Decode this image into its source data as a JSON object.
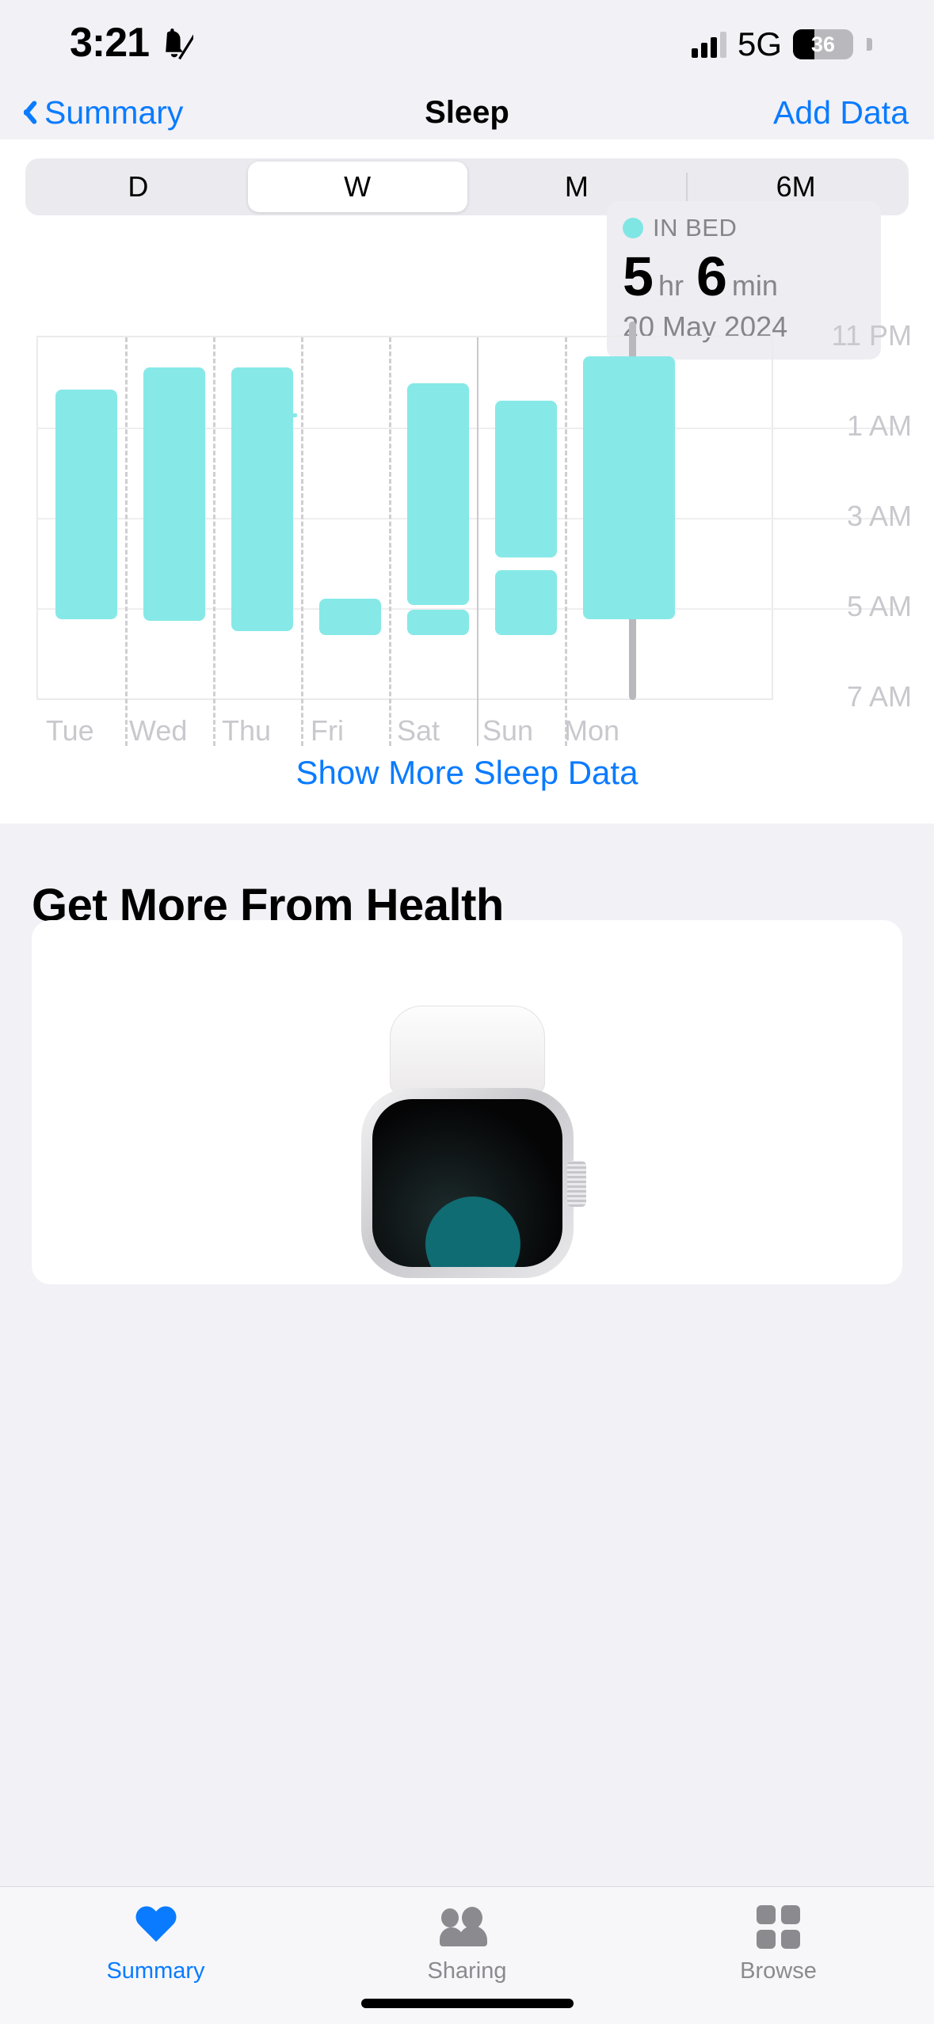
{
  "status_bar": {
    "time": "3:21",
    "silent_icon": "bell-slash-icon",
    "network": "5G",
    "battery_percent": "36"
  },
  "nav": {
    "back_label": "Summary",
    "title": "Sleep",
    "action_label": "Add Data"
  },
  "range_selector": {
    "options": [
      "D",
      "W",
      "M",
      "6M"
    ],
    "selected": "W"
  },
  "callout": {
    "label": "IN BED",
    "hours": "5",
    "hours_unit": "hr",
    "minutes": "6",
    "minutes_unit": "min",
    "date": "20 May 2024",
    "dot_color": "#7fe6e4"
  },
  "chart_data": {
    "type": "bar",
    "title": "In Bed",
    "xlabel": "",
    "ylabel": "",
    "categories": [
      "Tue",
      "Wed",
      "Thu",
      "Fri",
      "Sat",
      "Sun",
      "Mon"
    ],
    "y_tick_labels": [
      "11 PM",
      "1 AM",
      "3 AM",
      "5 AM",
      "7 AM"
    ],
    "ylim": [
      "11 PM",
      "7 AM"
    ],
    "grid": true,
    "legend": "IN BED",
    "bar_color": "#86e9e7",
    "unit": "clock time (range bars: bed time to wake time)",
    "series": [
      {
        "name": "In Bed",
        "segments": [
          {
            "day": "Tue",
            "start": "12:20 AM",
            "end": "5:05 AM"
          },
          {
            "day": "Wed",
            "start": "11:50 PM",
            "end": "5:05 AM"
          },
          {
            "day": "Thu",
            "start": "11:50 PM",
            "end": "5:20 AM"
          },
          {
            "day": "Fri",
            "start": "1:00 AM",
            "end": "1:02 AM"
          },
          {
            "day": "Fri",
            "start": "4:35 AM",
            "end": "5:20 AM"
          },
          {
            "day": "Sat",
            "start": "12:25 AM",
            "end": "4:45 AM"
          },
          {
            "day": "Sat",
            "start": "4:50 AM",
            "end": "5:20 AM"
          },
          {
            "day": "Sun",
            "start": "12:40 AM",
            "end": "3:35 AM"
          },
          {
            "day": "Sun",
            "start": "3:55 AM",
            "end": "5:20 AM"
          },
          {
            "day": "Mon",
            "start": "12:05 AM",
            "end": "5:11 AM"
          }
        ]
      }
    ],
    "selected_day": "Mon",
    "selected_value": "5 hr 6 min",
    "selected_date": "20 May 2024"
  },
  "show_more": {
    "label": "Show More Sleep Data"
  },
  "more_section": {
    "title": "Get More From Health",
    "card_image": "apple-watch-image"
  },
  "tabs": [
    {
      "label": "Summary",
      "icon": "heart-icon",
      "active": true
    },
    {
      "label": "Sharing",
      "icon": "people-icon",
      "active": false
    },
    {
      "label": "Browse",
      "icon": "grid-icon",
      "active": false
    }
  ]
}
